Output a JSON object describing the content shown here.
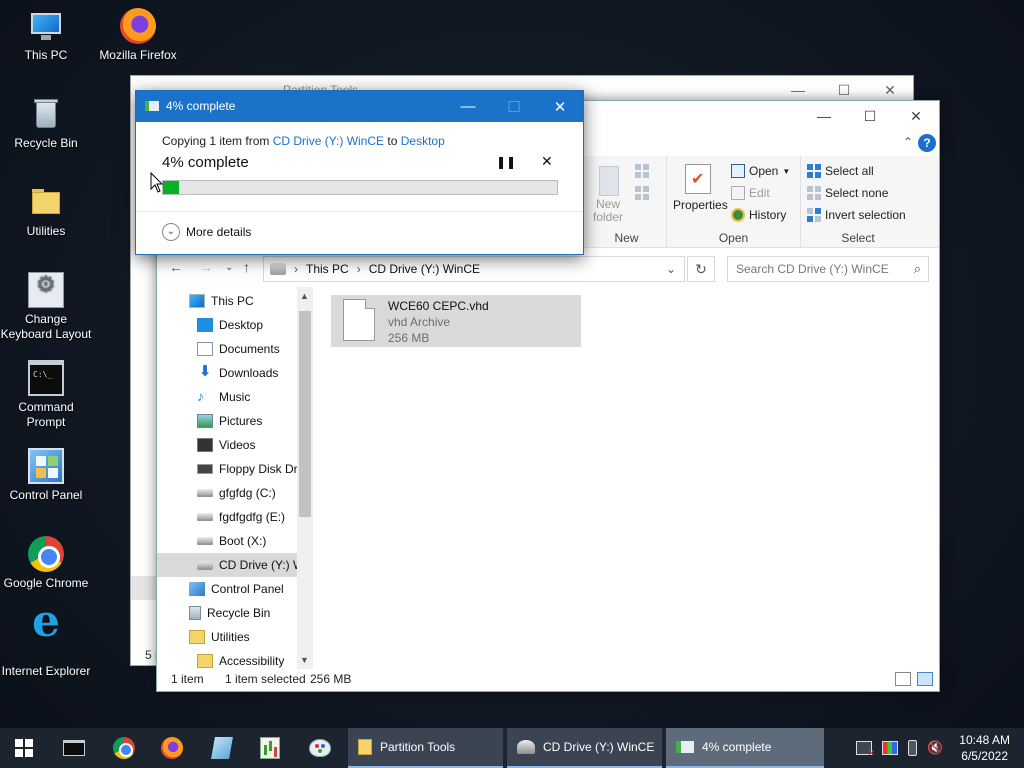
{
  "desktop": {
    "icons": [
      {
        "label": "This PC"
      },
      {
        "label": "Mozilla Firefox"
      },
      {
        "label": "Recycle Bin"
      },
      {
        "label": "Utilities"
      },
      {
        "label": "Change Keyboard Layout"
      },
      {
        "label": "Command Prompt"
      },
      {
        "label": "Control Panel"
      },
      {
        "label": "Google Chrome"
      },
      {
        "label": "Internet Explorer"
      }
    ]
  },
  "back_window": {
    "title": "Partition Tools",
    "status_partial": "5 i"
  },
  "explorer": {
    "ribbon": {
      "new": {
        "group_label": "New",
        "new_folder": "New\nfolder"
      },
      "open": {
        "group_label": "Open",
        "properties": "Properties",
        "open_btn": "Open",
        "edit": "Edit",
        "history": "History"
      },
      "select": {
        "group_label": "Select",
        "select_all": "Select all",
        "select_none": "Select none",
        "invert": "Invert selection"
      }
    },
    "address": {
      "crumbs": [
        "This PC",
        "CD Drive (Y:) WinCE"
      ]
    },
    "search": {
      "placeholder": "Search CD Drive (Y:) WinCE"
    },
    "nav_items": [
      {
        "label": "This PC"
      },
      {
        "label": "Desktop"
      },
      {
        "label": "Documents"
      },
      {
        "label": "Downloads"
      },
      {
        "label": "Music"
      },
      {
        "label": "Pictures"
      },
      {
        "label": "Videos"
      },
      {
        "label": "Floppy Disk Dri"
      },
      {
        "label": "gfgfdg (C:)"
      },
      {
        "label": "fgdfgdfg (E:)"
      },
      {
        "label": "Boot (X:)"
      },
      {
        "label": "CD Drive (Y:) W"
      },
      {
        "label": "Control Panel"
      },
      {
        "label": "Recycle Bin"
      },
      {
        "label": "Utilities"
      },
      {
        "label": "Accessibility"
      }
    ],
    "file": {
      "name": "WCE60 CEPC.vhd",
      "type": "vhd Archive",
      "size": "256 MB"
    },
    "status": {
      "count": "1 item",
      "selected": "1 item selected",
      "size": "256 MB"
    }
  },
  "copy_dialog": {
    "title": "4% complete",
    "line_prefix": "Copying 1 item from ",
    "source": "CD Drive (Y:) WinCE",
    "line_mid": " to ",
    "destination": "Desktop",
    "percent_text": "4% complete",
    "progress": 0.04,
    "more_details": "More details"
  },
  "taskbar": {
    "tasks": [
      {
        "label": "Partition Tools"
      },
      {
        "label": "CD Drive (Y:) WinCE"
      },
      {
        "label": "4% complete"
      }
    ],
    "time": "10:48 AM",
    "date": "6/5/2022"
  },
  "colors": {
    "accent": "#1a73c8",
    "progress_fill": "#06b025",
    "link": "#1a6fd1"
  }
}
